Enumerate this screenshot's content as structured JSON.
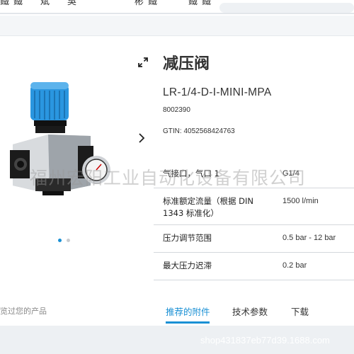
{
  "top": {
    "nav_text": "鐵鐵　斌　吳　　　　彬鐵　　鐵鐵"
  },
  "product": {
    "title": "减压阀",
    "model": "LR-1/4-D-I-MINI-MPA",
    "part_number": "8002390",
    "gtin": "GTIN: 4052568424763"
  },
  "gallery": {
    "slide_count": 2,
    "active_index": 0
  },
  "specs": [
    {
      "label": "气接口，气口 1",
      "value": "G1/4"
    },
    {
      "label": "标准额定流量（根据 DIN 1343 标准化）",
      "value": "1500 l/min"
    },
    {
      "label": "压力调节范围",
      "value": "0.5 bar - 12 bar"
    },
    {
      "label": "最大压力迟滞",
      "value": "0.2 bar"
    }
  ],
  "recent": {
    "text": "览过您的产品"
  },
  "tabs": [
    {
      "label": "推荐的附件",
      "active": true
    },
    {
      "label": "技术参数",
      "active": false
    },
    {
      "label": "下载",
      "active": false
    }
  ],
  "watermark": {
    "company": "福州宏阳工业自动化设备有限公司",
    "url": "shop431837eb77d39.1688.com"
  },
  "colors": {
    "accent": "#1a90d4",
    "knob_blue": "#2a96e0",
    "divider": "#d4d8dc",
    "band": "#edf0f3"
  },
  "icons": {
    "expand": "expand-arrows-icon",
    "next": "chevron-right-icon"
  }
}
